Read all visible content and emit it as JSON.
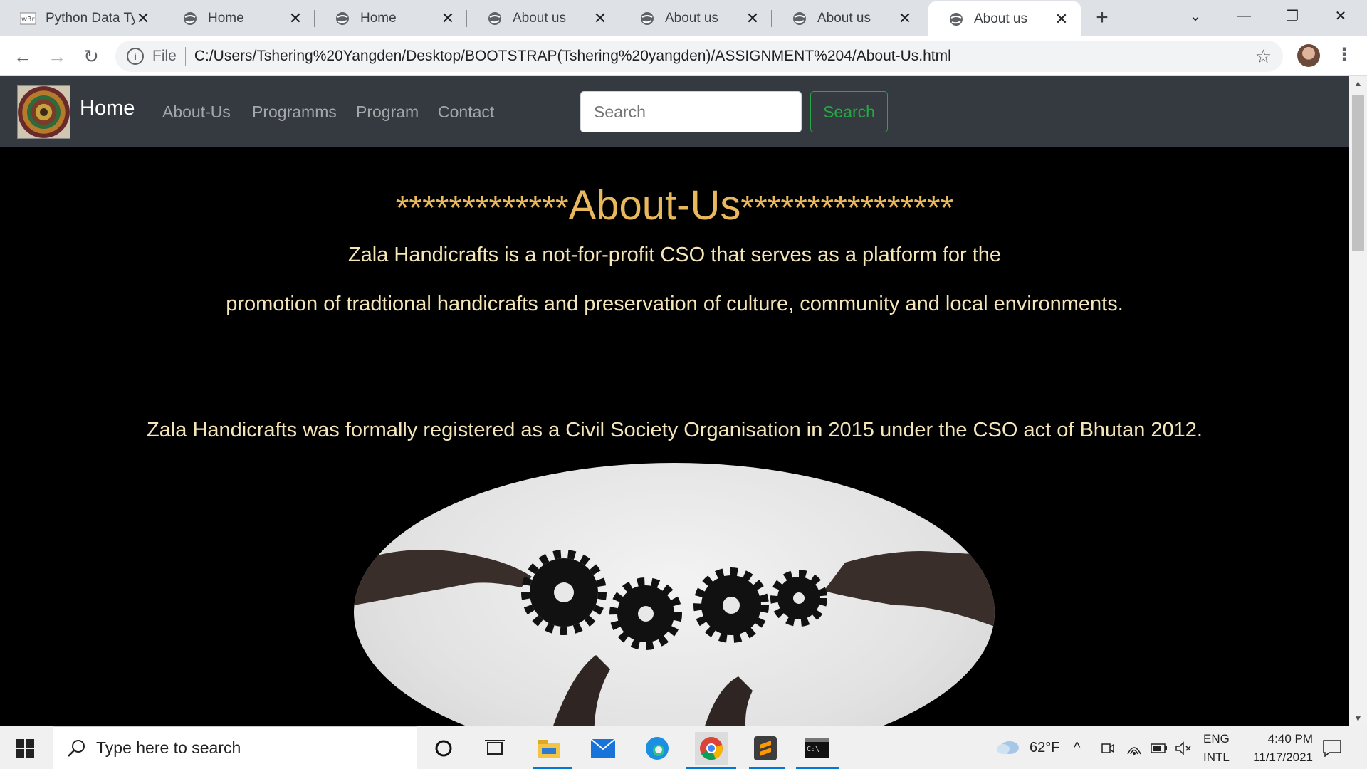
{
  "browser": {
    "tabs": [
      {
        "title": "Python Data Ty",
        "favicon": "w3r",
        "active": false
      },
      {
        "title": "Home",
        "favicon": "globe-icon",
        "active": false
      },
      {
        "title": "Home",
        "favicon": "globe-icon",
        "active": false
      },
      {
        "title": "About us",
        "favicon": "globe-icon",
        "active": false
      },
      {
        "title": "About us",
        "favicon": "globe-icon",
        "active": false
      },
      {
        "title": "About us",
        "favicon": "globe-icon",
        "active": false
      },
      {
        "title": "About us",
        "favicon": "globe-icon",
        "active": true
      }
    ],
    "address": {
      "scheme": "File",
      "url": "C:/Users/Tshering%20Yangden/Desktop/BOOTSTRAP(Tshering%20yangden)/ASSIGNMENT%204/About-Us.html"
    }
  },
  "navbar": {
    "brand": "Home",
    "links": [
      "About-Us",
      "Programms",
      "Program",
      "Contact"
    ],
    "search_placeholder": "Search",
    "search_button": "Search",
    "bg_color": "#343a40",
    "button_color": "#28a745"
  },
  "content": {
    "heading_prefix": "*************",
    "heading_text": "About-Us",
    "heading_suffix": "****************",
    "heading_color": "#e9b85c",
    "para1_line1": "Zala Handicrafts is a not-for-profit CSO that serves as a platform for the",
    "para1_line2": "promotion of tradtional handicrafts and preservation of culture, community and local environments.",
    "para2": "Zala Handicrafts was formally registered as a Civil Society Organisation in 2015 under the CSO act of Bhutan 2012.",
    "text_color": "#f5e6b8"
  },
  "taskbar": {
    "search_placeholder": "Type here to search",
    "weather": "62°F",
    "lang_top": "ENG",
    "lang_bottom": "INTL",
    "time": "4:40 PM",
    "date": "11/17/2021"
  }
}
